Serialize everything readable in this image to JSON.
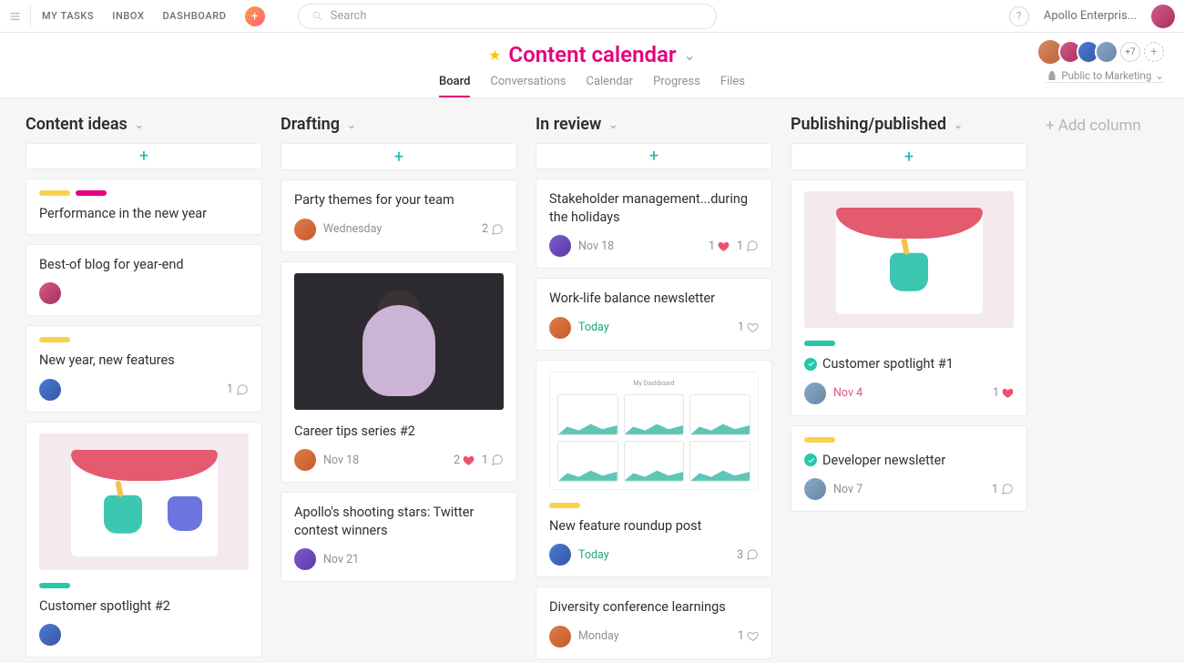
{
  "topnav": {
    "links": [
      "MY TASKS",
      "INBOX",
      "DASHBOARD"
    ],
    "search_placeholder": "Search",
    "help": "?",
    "workspace": "Apollo Enterpris..."
  },
  "project": {
    "title": "Content calendar",
    "tabs": [
      "Board",
      "Conversations",
      "Calendar",
      "Progress",
      "Files"
    ],
    "active_tab": "Board",
    "members_overflow": "+7",
    "visibility": "Public to Marketing"
  },
  "board": {
    "add_column_label": "+ Add column",
    "columns": [
      {
        "title": "Content ideas",
        "cards": [
          {
            "tags": [
              "yellow",
              "pink"
            ],
            "title": "Performance in the new year"
          },
          {
            "tags": [],
            "title": "Best-of blog for year-end",
            "avatar": "av-c"
          },
          {
            "tags": [
              "yellow"
            ],
            "title": "New year, new features",
            "avatar": "av-b",
            "comments": 1
          },
          {
            "cover": "thumb-stage thumb-stage2",
            "tags": [
              "teal"
            ],
            "title": "Customer spotlight #2",
            "avatar": "av-b"
          }
        ]
      },
      {
        "title": "Drafting",
        "cards": [
          {
            "tags": [],
            "title": "Party themes for your team",
            "avatar": "av-d",
            "date": "Wednesday",
            "comments": 2
          },
          {
            "cover": "thumb-woman",
            "tags": [],
            "title": "Career tips series #2",
            "avatar": "av-d",
            "date": "Nov 18",
            "likes": 2,
            "liked": true,
            "comments": 1
          },
          {
            "tags": [],
            "title": "Apollo's shooting stars: Twitter contest winners",
            "avatar": "av-e",
            "date": "Nov 21"
          }
        ]
      },
      {
        "title": "In review",
        "cards": [
          {
            "tags": [],
            "title": "Stakeholder management...during the holidays",
            "avatar": "av-e",
            "date": "Nov 18",
            "likes": 1,
            "liked": true,
            "comments": 1
          },
          {
            "tags": [],
            "title": "Work-life balance newsletter",
            "avatar": "av-d",
            "date": "Today",
            "date_style": "green",
            "hearts_hollow": 1
          },
          {
            "cover": "thumb-dash",
            "tags": [
              "yellow"
            ],
            "title": "New feature roundup post",
            "avatar": "av-b",
            "date": "Today",
            "date_style": "green",
            "comments": 3
          },
          {
            "tags": [],
            "title": "Diversity conference learnings",
            "avatar": "av-d",
            "date": "Monday",
            "hearts_hollow": 1
          }
        ]
      },
      {
        "title": "Publishing/published",
        "cards": [
          {
            "cover": "thumb-stage",
            "tags": [
              "teal"
            ],
            "completed": true,
            "title": "Customer spotlight #1",
            "avatar": "av-f",
            "date": "Nov 4",
            "date_style": "red",
            "likes": 1,
            "liked": true
          },
          {
            "tags": [
              "yellow"
            ],
            "completed": true,
            "title": "Developer newsletter",
            "avatar": "av-f",
            "date": "Nov 7",
            "comments": 1
          }
        ]
      }
    ]
  }
}
